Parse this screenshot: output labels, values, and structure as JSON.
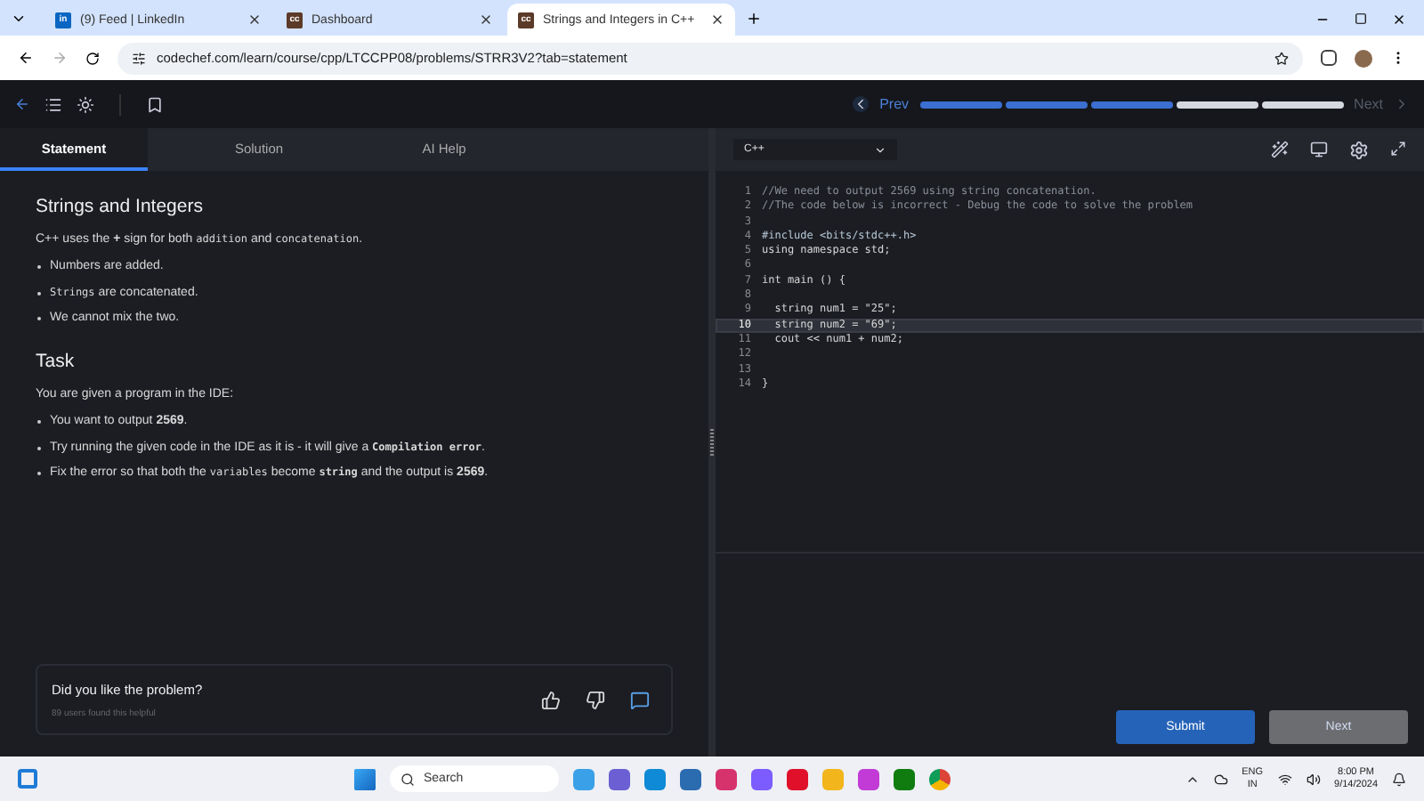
{
  "browser": {
    "tabs": [
      {
        "title": "(9) Feed | LinkedIn",
        "icon": "in",
        "selected": false
      },
      {
        "title": "Dashboard",
        "icon": "cc",
        "selected": false
      },
      {
        "title": "Strings and Integers in C++",
        "icon": "cc",
        "selected": true
      }
    ],
    "url": "codechef.com/learn/course/cpp/LTCCPP08/problems/STRR3V2?tab=statement"
  },
  "header": {
    "prev": "Prev",
    "next": "Next",
    "progress": [
      {
        "done": true
      },
      {
        "done": true
      },
      {
        "done": true
      },
      {
        "done": false
      },
      {
        "done": false
      }
    ]
  },
  "panel_tabs": [
    {
      "label": "Statement",
      "selected": true
    },
    {
      "label": "Solution",
      "selected": false
    },
    {
      "label": "AI Help",
      "selected": false
    }
  ],
  "statement": {
    "title": "Strings and Integers",
    "intro": [
      {
        "t": "C++ uses the ",
        "bold": false,
        "mono": false
      },
      {
        "t": "+",
        "bold": true,
        "mono": false
      },
      {
        "t": " sign for both ",
        "bold": false,
        "mono": false
      },
      {
        "t": "addition",
        "bold": false,
        "mono": true
      },
      {
        "t": " and ",
        "bold": false,
        "mono": false
      },
      {
        "t": "concatenation",
        "bold": false,
        "mono": true
      },
      {
        "t": ".",
        "bold": false,
        "mono": false
      }
    ],
    "bullets": [
      [
        {
          "t": "Numbers are added.",
          "bold": false,
          "mono": false
        }
      ],
      [
        {
          "t": "Strings",
          "bold": false,
          "mono": true
        },
        {
          "t": " are concatenated.",
          "bold": false,
          "mono": false
        }
      ],
      [
        {
          "t": "We cannot mix the two.",
          "bold": false,
          "mono": false
        }
      ]
    ],
    "task_title": "Task",
    "task_intro": [
      {
        "t": "You are given a program in the IDE:",
        "bold": false,
        "mono": false
      }
    ],
    "task_bullets": [
      [
        {
          "t": "You want to output ",
          "bold": false,
          "mono": false
        },
        {
          "t": "2569",
          "bold": true,
          "mono": false
        },
        {
          "t": ".",
          "bold": false,
          "mono": false
        }
      ],
      [
        {
          "t": "Try running the given code in the IDE as it is - it will give a ",
          "bold": false,
          "mono": false
        },
        {
          "t": "Compilation error",
          "bold": true,
          "mono": true
        },
        {
          "t": ".",
          "bold": false,
          "mono": false
        }
      ],
      [
        {
          "t": "Fix the error so that both the ",
          "bold": false,
          "mono": false
        },
        {
          "t": "variables",
          "bold": false,
          "mono": true
        },
        {
          "t": " become ",
          "bold": false,
          "mono": false
        },
        {
          "t": "string",
          "bold": true,
          "mono": true
        },
        {
          "t": " and the output is ",
          "bold": false,
          "mono": false
        },
        {
          "t": "2569",
          "bold": true,
          "mono": false
        },
        {
          "t": ".",
          "bold": false,
          "mono": false
        }
      ]
    ]
  },
  "feedback": {
    "question": "Did you like the problem?",
    "count": "89 users found this helpful"
  },
  "editor": {
    "language": "C++",
    "lines": [
      {
        "n": "1",
        "kind": "comment",
        "text": "//We need to output 2569 using string concatenation.",
        "highlighted": false
      },
      {
        "n": "2",
        "kind": "comment",
        "text": "//The code below is incorrect - Debug the code to solve the problem",
        "highlighted": false
      },
      {
        "n": "3",
        "kind": "blank",
        "highlighted": false
      },
      {
        "n": "4",
        "kind": "preprocessor",
        "text": "#include <bits/stdc++.h>",
        "highlighted": false
      },
      {
        "n": "5",
        "kind": "code",
        "text": "using namespace std;",
        "highlighted": false
      },
      {
        "n": "6",
        "kind": "blank",
        "highlighted": false
      },
      {
        "n": "7",
        "kind": "code",
        "text": "int main () {",
        "highlighted": false
      },
      {
        "n": "8",
        "kind": "blank",
        "highlighted": false
      },
      {
        "n": "9",
        "kind": "code",
        "text": "  string num1 = \"25\";",
        "highlighted": false
      },
      {
        "n": "10",
        "kind": "code",
        "text": "  string num2 = \"69\";",
        "highlighted": true
      },
      {
        "n": "11",
        "kind": "code",
        "text": "  cout << num1 + num2;",
        "highlighted": false
      },
      {
        "n": "12",
        "kind": "blank",
        "highlighted": false
      },
      {
        "n": "13",
        "kind": "blank",
        "highlighted": false
      },
      {
        "n": "14",
        "kind": "code",
        "text": "}",
        "highlighted": false
      }
    ],
    "submit": "Submit",
    "next": "Next"
  },
  "taskbar": {
    "search": "Search",
    "lang": "ENG",
    "region": "IN",
    "time": "8:00 PM",
    "date": "9/14/2024"
  }
}
